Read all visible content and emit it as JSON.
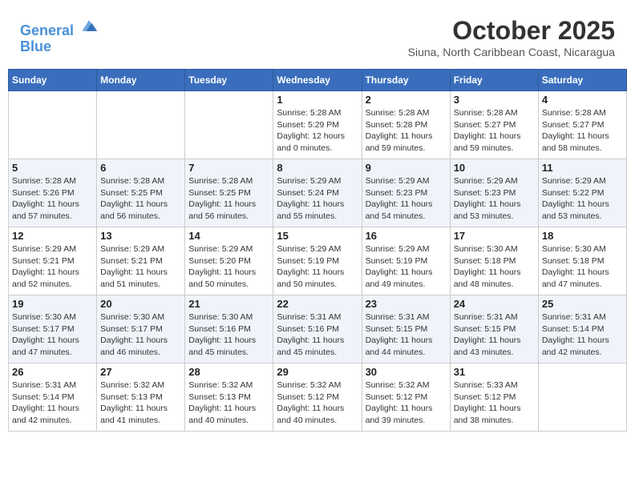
{
  "header": {
    "logo_line1": "General",
    "logo_line2": "Blue",
    "month": "October 2025",
    "location": "Siuna, North Caribbean Coast, Nicaragua"
  },
  "days_of_week": [
    "Sunday",
    "Monday",
    "Tuesday",
    "Wednesday",
    "Thursday",
    "Friday",
    "Saturday"
  ],
  "weeks": [
    [
      {
        "day": "",
        "info": ""
      },
      {
        "day": "",
        "info": ""
      },
      {
        "day": "",
        "info": ""
      },
      {
        "day": "1",
        "info": "Sunrise: 5:28 AM\nSunset: 5:29 PM\nDaylight: 12 hours\nand 0 minutes."
      },
      {
        "day": "2",
        "info": "Sunrise: 5:28 AM\nSunset: 5:28 PM\nDaylight: 11 hours\nand 59 minutes."
      },
      {
        "day": "3",
        "info": "Sunrise: 5:28 AM\nSunset: 5:27 PM\nDaylight: 11 hours\nand 59 minutes."
      },
      {
        "day": "4",
        "info": "Sunrise: 5:28 AM\nSunset: 5:27 PM\nDaylight: 11 hours\nand 58 minutes."
      }
    ],
    [
      {
        "day": "5",
        "info": "Sunrise: 5:28 AM\nSunset: 5:26 PM\nDaylight: 11 hours\nand 57 minutes."
      },
      {
        "day": "6",
        "info": "Sunrise: 5:28 AM\nSunset: 5:25 PM\nDaylight: 11 hours\nand 56 minutes."
      },
      {
        "day": "7",
        "info": "Sunrise: 5:28 AM\nSunset: 5:25 PM\nDaylight: 11 hours\nand 56 minutes."
      },
      {
        "day": "8",
        "info": "Sunrise: 5:29 AM\nSunset: 5:24 PM\nDaylight: 11 hours\nand 55 minutes."
      },
      {
        "day": "9",
        "info": "Sunrise: 5:29 AM\nSunset: 5:23 PM\nDaylight: 11 hours\nand 54 minutes."
      },
      {
        "day": "10",
        "info": "Sunrise: 5:29 AM\nSunset: 5:23 PM\nDaylight: 11 hours\nand 53 minutes."
      },
      {
        "day": "11",
        "info": "Sunrise: 5:29 AM\nSunset: 5:22 PM\nDaylight: 11 hours\nand 53 minutes."
      }
    ],
    [
      {
        "day": "12",
        "info": "Sunrise: 5:29 AM\nSunset: 5:21 PM\nDaylight: 11 hours\nand 52 minutes."
      },
      {
        "day": "13",
        "info": "Sunrise: 5:29 AM\nSunset: 5:21 PM\nDaylight: 11 hours\nand 51 minutes."
      },
      {
        "day": "14",
        "info": "Sunrise: 5:29 AM\nSunset: 5:20 PM\nDaylight: 11 hours\nand 50 minutes."
      },
      {
        "day": "15",
        "info": "Sunrise: 5:29 AM\nSunset: 5:19 PM\nDaylight: 11 hours\nand 50 minutes."
      },
      {
        "day": "16",
        "info": "Sunrise: 5:29 AM\nSunset: 5:19 PM\nDaylight: 11 hours\nand 49 minutes."
      },
      {
        "day": "17",
        "info": "Sunrise: 5:30 AM\nSunset: 5:18 PM\nDaylight: 11 hours\nand 48 minutes."
      },
      {
        "day": "18",
        "info": "Sunrise: 5:30 AM\nSunset: 5:18 PM\nDaylight: 11 hours\nand 47 minutes."
      }
    ],
    [
      {
        "day": "19",
        "info": "Sunrise: 5:30 AM\nSunset: 5:17 PM\nDaylight: 11 hours\nand 47 minutes."
      },
      {
        "day": "20",
        "info": "Sunrise: 5:30 AM\nSunset: 5:17 PM\nDaylight: 11 hours\nand 46 minutes."
      },
      {
        "day": "21",
        "info": "Sunrise: 5:30 AM\nSunset: 5:16 PM\nDaylight: 11 hours\nand 45 minutes."
      },
      {
        "day": "22",
        "info": "Sunrise: 5:31 AM\nSunset: 5:16 PM\nDaylight: 11 hours\nand 45 minutes."
      },
      {
        "day": "23",
        "info": "Sunrise: 5:31 AM\nSunset: 5:15 PM\nDaylight: 11 hours\nand 44 minutes."
      },
      {
        "day": "24",
        "info": "Sunrise: 5:31 AM\nSunset: 5:15 PM\nDaylight: 11 hours\nand 43 minutes."
      },
      {
        "day": "25",
        "info": "Sunrise: 5:31 AM\nSunset: 5:14 PM\nDaylight: 11 hours\nand 42 minutes."
      }
    ],
    [
      {
        "day": "26",
        "info": "Sunrise: 5:31 AM\nSunset: 5:14 PM\nDaylight: 11 hours\nand 42 minutes."
      },
      {
        "day": "27",
        "info": "Sunrise: 5:32 AM\nSunset: 5:13 PM\nDaylight: 11 hours\nand 41 minutes."
      },
      {
        "day": "28",
        "info": "Sunrise: 5:32 AM\nSunset: 5:13 PM\nDaylight: 11 hours\nand 40 minutes."
      },
      {
        "day": "29",
        "info": "Sunrise: 5:32 AM\nSunset: 5:12 PM\nDaylight: 11 hours\nand 40 minutes."
      },
      {
        "day": "30",
        "info": "Sunrise: 5:32 AM\nSunset: 5:12 PM\nDaylight: 11 hours\nand 39 minutes."
      },
      {
        "day": "31",
        "info": "Sunrise: 5:33 AM\nSunset: 5:12 PM\nDaylight: 11 hours\nand 38 minutes."
      },
      {
        "day": "",
        "info": ""
      }
    ]
  ]
}
